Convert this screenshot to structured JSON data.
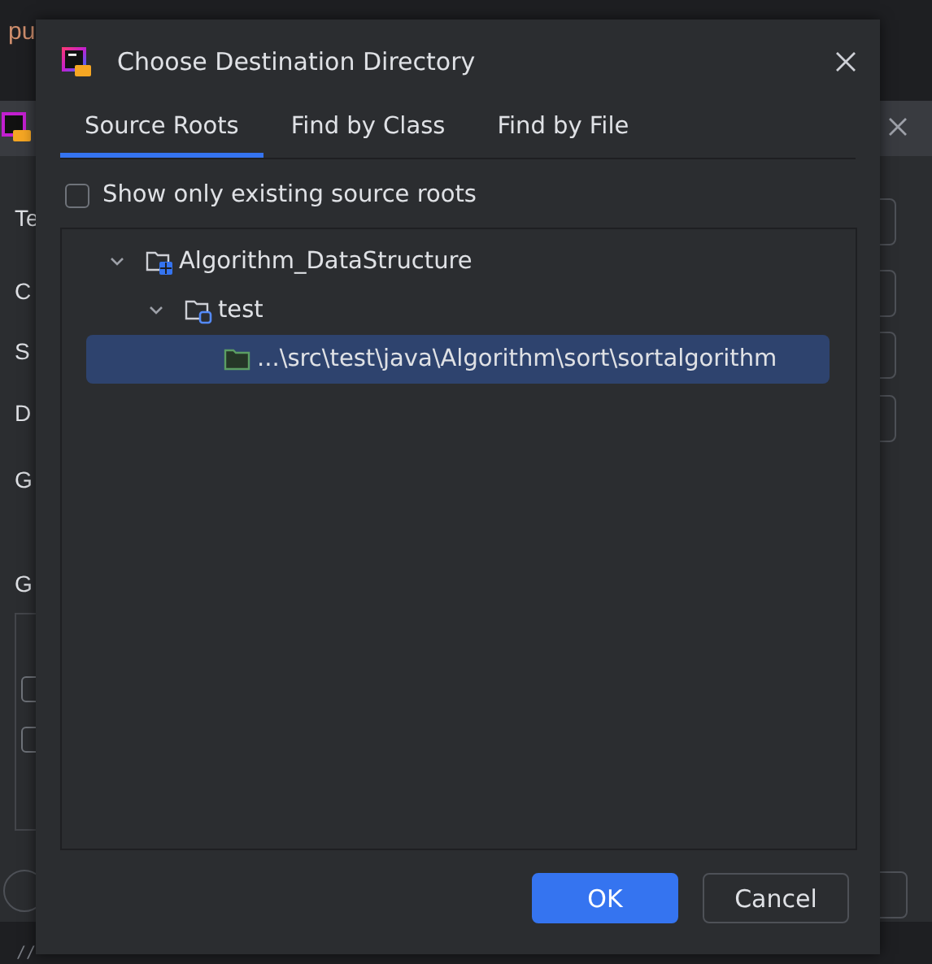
{
  "background": {
    "editor_text": "pu",
    "form_labels": [
      "Te",
      "C",
      "S",
      "D",
      "G",
      "G"
    ],
    "code_line": [
      "//"
    ],
    "checkboxes": [
      {
        "checked": false
      },
      {
        "checked": false
      }
    ]
  },
  "dialog": {
    "title": "Choose Destination Directory",
    "tabs": [
      {
        "label": "Source Roots",
        "selected": true
      },
      {
        "label": "Find by Class",
        "selected": false
      },
      {
        "label": "Find by File",
        "selected": false
      }
    ],
    "checkbox": {
      "label": "Show only existing source roots",
      "checked": false
    },
    "tree": [
      {
        "label": "Algorithm_DataStructure",
        "kind": "module",
        "expanded": true,
        "selected": false,
        "children": [
          {
            "label": "test",
            "kind": "test_root",
            "expanded": true,
            "selected": false,
            "children": [
              {
                "label": "...\\src\\test\\java\\Algorithm\\sort\\sortalgorithm",
                "kind": "package",
                "selected": true
              }
            ]
          }
        ]
      }
    ],
    "buttons": [
      {
        "label": "OK",
        "kind": "primary"
      },
      {
        "label": "Cancel",
        "kind": "secondary"
      }
    ]
  }
}
